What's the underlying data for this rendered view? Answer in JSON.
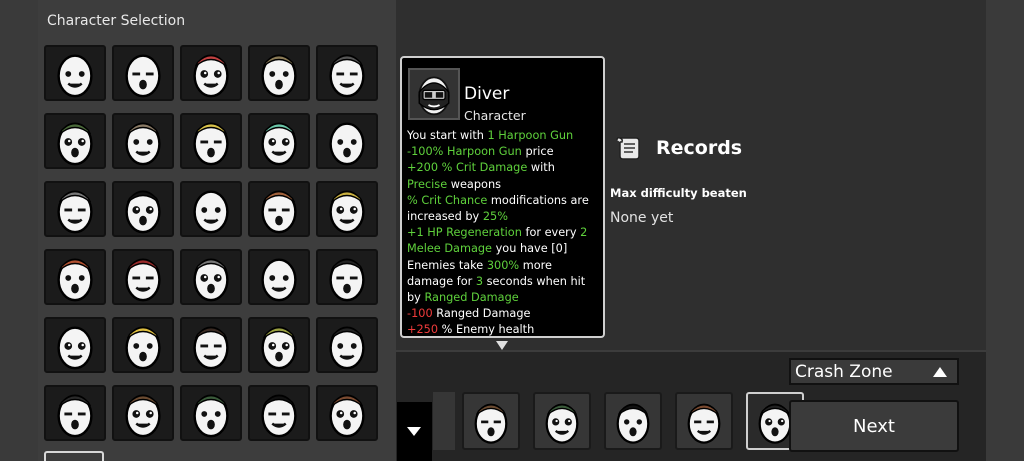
{
  "selection_panel": {
    "title": "Character Selection",
    "grid": [
      {
        "row": 0,
        "col": 0,
        "icon": "character-egg-plain-icon",
        "accent": "#ffffff"
      },
      {
        "row": 0,
        "col": 1,
        "icon": "character-egg-neutral-icon",
        "accent": "#ffffff"
      },
      {
        "row": 0,
        "col": 2,
        "icon": "character-egg-cyborg-icon",
        "accent": "#c04040"
      },
      {
        "row": 0,
        "col": 3,
        "icon": "character-egg-scarf-icon",
        "accent": "#8a7a55"
      },
      {
        "row": 0,
        "col": 4,
        "icon": "character-egg-eyepatch-icon",
        "accent": "#555555"
      },
      {
        "row": 1,
        "col": 0,
        "icon": "character-egg-hat-icon",
        "accent": "#4a6a3a"
      },
      {
        "row": 1,
        "col": 1,
        "icon": "character-egg-brown-icon",
        "accent": "#8a7a65"
      },
      {
        "row": 1,
        "col": 2,
        "icon": "character-egg-crown-icon",
        "accent": "#d9c24a"
      },
      {
        "row": 1,
        "col": 3,
        "icon": "character-egg-mohawk-icon",
        "accent": "#6ac6a8"
      },
      {
        "row": 1,
        "col": 4,
        "icon": "character-egg-bored-icon",
        "accent": "#ffffff"
      },
      {
        "row": 2,
        "col": 0,
        "icon": "character-egg-goggles-icon",
        "accent": "#777777"
      },
      {
        "row": 2,
        "col": 1,
        "icon": "character-egg-visor-icon",
        "accent": "#111111"
      },
      {
        "row": 2,
        "col": 2,
        "icon": "character-egg-angry-icon",
        "accent": "#ffffff"
      },
      {
        "row": 2,
        "col": 3,
        "icon": "character-egg-mustache-icon",
        "accent": "#a0603a"
      },
      {
        "row": 2,
        "col": 4,
        "icon": "character-egg-horns-icon",
        "accent": "#c9b040"
      },
      {
        "row": 3,
        "col": 0,
        "icon": "character-egg-pacifier-icon",
        "accent": "#b05030"
      },
      {
        "row": 3,
        "col": 1,
        "icon": "character-egg-scarf-red-icon",
        "accent": "#9a2a2a"
      },
      {
        "row": 3,
        "col": 2,
        "icon": "character-egg-monocle-icon",
        "accent": "#777777"
      },
      {
        "row": 3,
        "col": 3,
        "icon": "character-egg-chubby-icon",
        "accent": "#ffffff"
      },
      {
        "row": 3,
        "col": 4,
        "icon": "character-egg-bowler-icon",
        "accent": "#222222"
      },
      {
        "row": 4,
        "col": 0,
        "icon": "character-egg-shocked-icon",
        "accent": "#ffffff"
      },
      {
        "row": 4,
        "col": 1,
        "icon": "character-egg-hardhat-icon",
        "accent": "#e0c040"
      },
      {
        "row": 4,
        "col": 2,
        "icon": "character-egg-beard-icon",
        "accent": "#3a2a22"
      },
      {
        "row": 4,
        "col": 3,
        "icon": "character-egg-gasmask-icon",
        "accent": "#9aa040"
      },
      {
        "row": 4,
        "col": 4,
        "icon": "character-egg-gentleman-icon",
        "accent": "#222222"
      },
      {
        "row": 5,
        "col": 0,
        "icon": "character-egg-dreadlocks-icon",
        "accent": "#2a2a2a"
      },
      {
        "row": 5,
        "col": 1,
        "icon": "character-egg-lumberjack-icon",
        "accent": "#6a4a30"
      },
      {
        "row": 5,
        "col": 2,
        "icon": "character-egg-beanie-icon",
        "accent": "#3a5a3a"
      },
      {
        "row": 5,
        "col": 3,
        "icon": "character-egg-fedora-icon",
        "accent": "#111111"
      },
      {
        "row": 5,
        "col": 4,
        "icon": "character-egg-pirate-icon",
        "accent": "#7a4a30"
      }
    ]
  },
  "tooltip": {
    "name": "Diver",
    "kind": "Character",
    "portrait_icon": "diver-mask-icon",
    "lines": {
      "l1a": "You start with ",
      "l1b": "1 Harpoon Gun",
      "l2a": "-100% Harpoon Gun",
      "l2b": " price",
      "l3a": "+200  % Crit Damage",
      "l3b": " with",
      "l4a": "Precise",
      "l4b": " weapons",
      "l5a": "% Crit Chance",
      "l5b": " modifications are",
      "l6a": "increased by ",
      "l6b": "25%",
      "l7a": "+1  HP Regeneration",
      "l7b": " for every ",
      "l7c": "2",
      "l8a": "Melee Damage",
      "l8b": " you have [0]",
      "l9a": "Enemies take ",
      "l9b": "300%",
      "l9c": " more",
      "l10a": "damage for ",
      "l10b": "3",
      "l10c": " seconds when hit",
      "l11a": "by ",
      "l11b": "Ranged Damage",
      "l12a": "-100",
      "l12b": " Ranged Damage",
      "l13a": "+250",
      "l13b": " % Enemy health"
    }
  },
  "records": {
    "title": "Records",
    "icon": "scroll-icon",
    "max_difficulty_label": "Max difficulty beaten",
    "max_difficulty_value": "None yet"
  },
  "recent_characters": [
    {
      "icon": "character-egg-lumberjack-icon"
    },
    {
      "icon": "character-egg-beanie-icon"
    },
    {
      "icon": "character-egg-fedora-icon"
    },
    {
      "icon": "character-egg-pirate-icon"
    },
    {
      "icon": "character-egg-diver-icon",
      "active": true
    }
  ],
  "zone_dropdown": {
    "selected": "Crash Zone"
  },
  "next_button": {
    "label": "Next"
  },
  "colors": {
    "positive": "#5fd13c",
    "negative": "#ef3b3b",
    "panel": "#3d3d3d"
  }
}
